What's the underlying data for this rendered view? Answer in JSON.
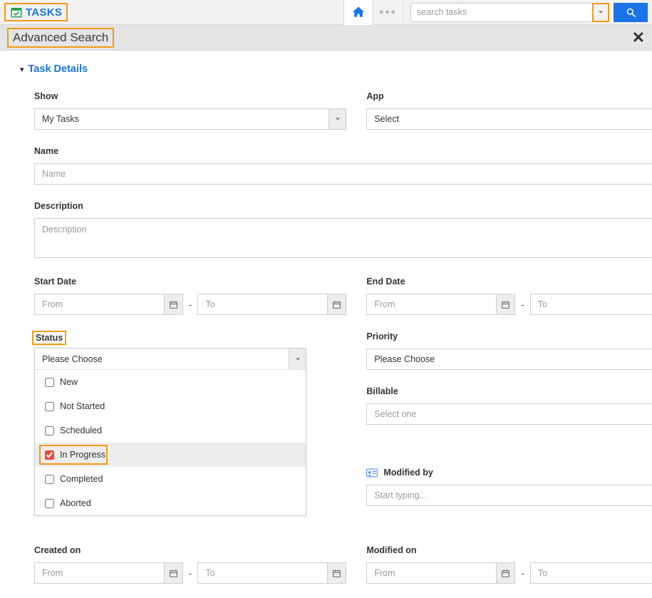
{
  "topbar": {
    "brand": "TASKS",
    "search_placeholder": "search tasks"
  },
  "subheader": {
    "title": "Advanced Search"
  },
  "section": {
    "title": "Task Details"
  },
  "fields": {
    "show": {
      "label": "Show",
      "value": "My Tasks"
    },
    "app": {
      "label": "App",
      "value": "Select"
    },
    "name": {
      "label": "Name",
      "placeholder": "Name"
    },
    "description": {
      "label": "Description",
      "placeholder": "Description"
    },
    "start_date": {
      "label": "Start Date",
      "from": "From",
      "to": "To"
    },
    "end_date": {
      "label": "End Date",
      "from": "From",
      "to": "To"
    },
    "status": {
      "label": "Status",
      "placeholder": "Please Choose",
      "options": {
        "o0": "New",
        "o1": "Not Started",
        "o2": "Scheduled",
        "o3": "In Progress",
        "o4": "Completed",
        "o5": "Aborted"
      }
    },
    "priority": {
      "label": "Priority",
      "placeholder": "Please Choose"
    },
    "billable": {
      "label": "Billable",
      "placeholder": "Select one"
    },
    "modified_by": {
      "label": "Modified by",
      "placeholder": "Start typing..."
    },
    "created_on": {
      "label": "Created on",
      "from": "From",
      "to": "To"
    },
    "modified_on": {
      "label": "Modified on",
      "from": "From",
      "to": "To"
    }
  }
}
